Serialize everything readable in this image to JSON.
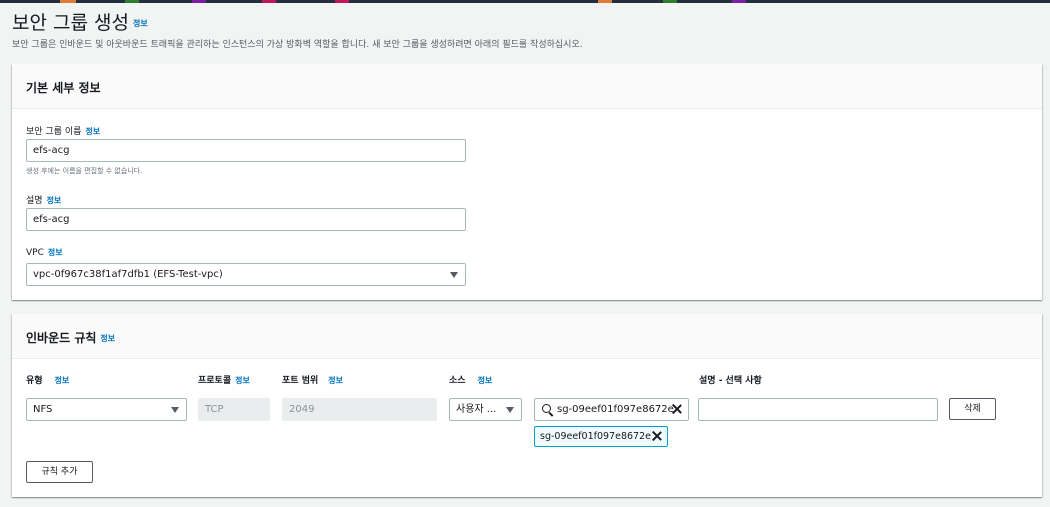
{
  "colors": {
    "accent": "#0073bb",
    "border": "#aab7b8",
    "token_border": "#00a1c9"
  },
  "page": {
    "title": "보안 그룹 생성",
    "info": "정보",
    "description": "보안 그룹은 인바운드 및 아웃바운드 트래픽을 관리하는 인스턴스의 가상 방화벽 역할을 합니다. 새 보안 그룹을 생성하려면 아래의 필드를 작성하십시오."
  },
  "basic": {
    "title": "기본 세부 정보",
    "name_label": "보안 그룹 이름",
    "name_info": "정보",
    "name_value": "efs-acg",
    "name_hint": "생성 후에는 이름을 편집할 수 없습니다.",
    "desc_label": "설명",
    "desc_info": "정보",
    "desc_value": "efs-acg",
    "vpc_label": "VPC",
    "vpc_info": "정보",
    "vpc_value": "vpc-0f967c38f1af7dfb1 (EFS-Test-vpc)"
  },
  "inbound": {
    "title": "인바운드 규칙",
    "info": "정보",
    "col_type": "유형",
    "col_type_info": "정보",
    "col_protocol": "프로토콜",
    "col_protocol_info": "정보",
    "col_port": "포트 범위",
    "col_port_info": "정보",
    "col_source": "소스",
    "col_source_info": "정보",
    "col_desc": "설명 - 선택 사항",
    "rule": {
      "type": "NFS",
      "protocol": "TCP",
      "port": "2049",
      "source_type": "사용자 ...",
      "source_search": "sg-09eef01f097e8672e",
      "source_token": "sg-09eef01f097e8672e",
      "description": ""
    },
    "delete_label": "삭제",
    "add_rule_label": "규칙 추가"
  }
}
